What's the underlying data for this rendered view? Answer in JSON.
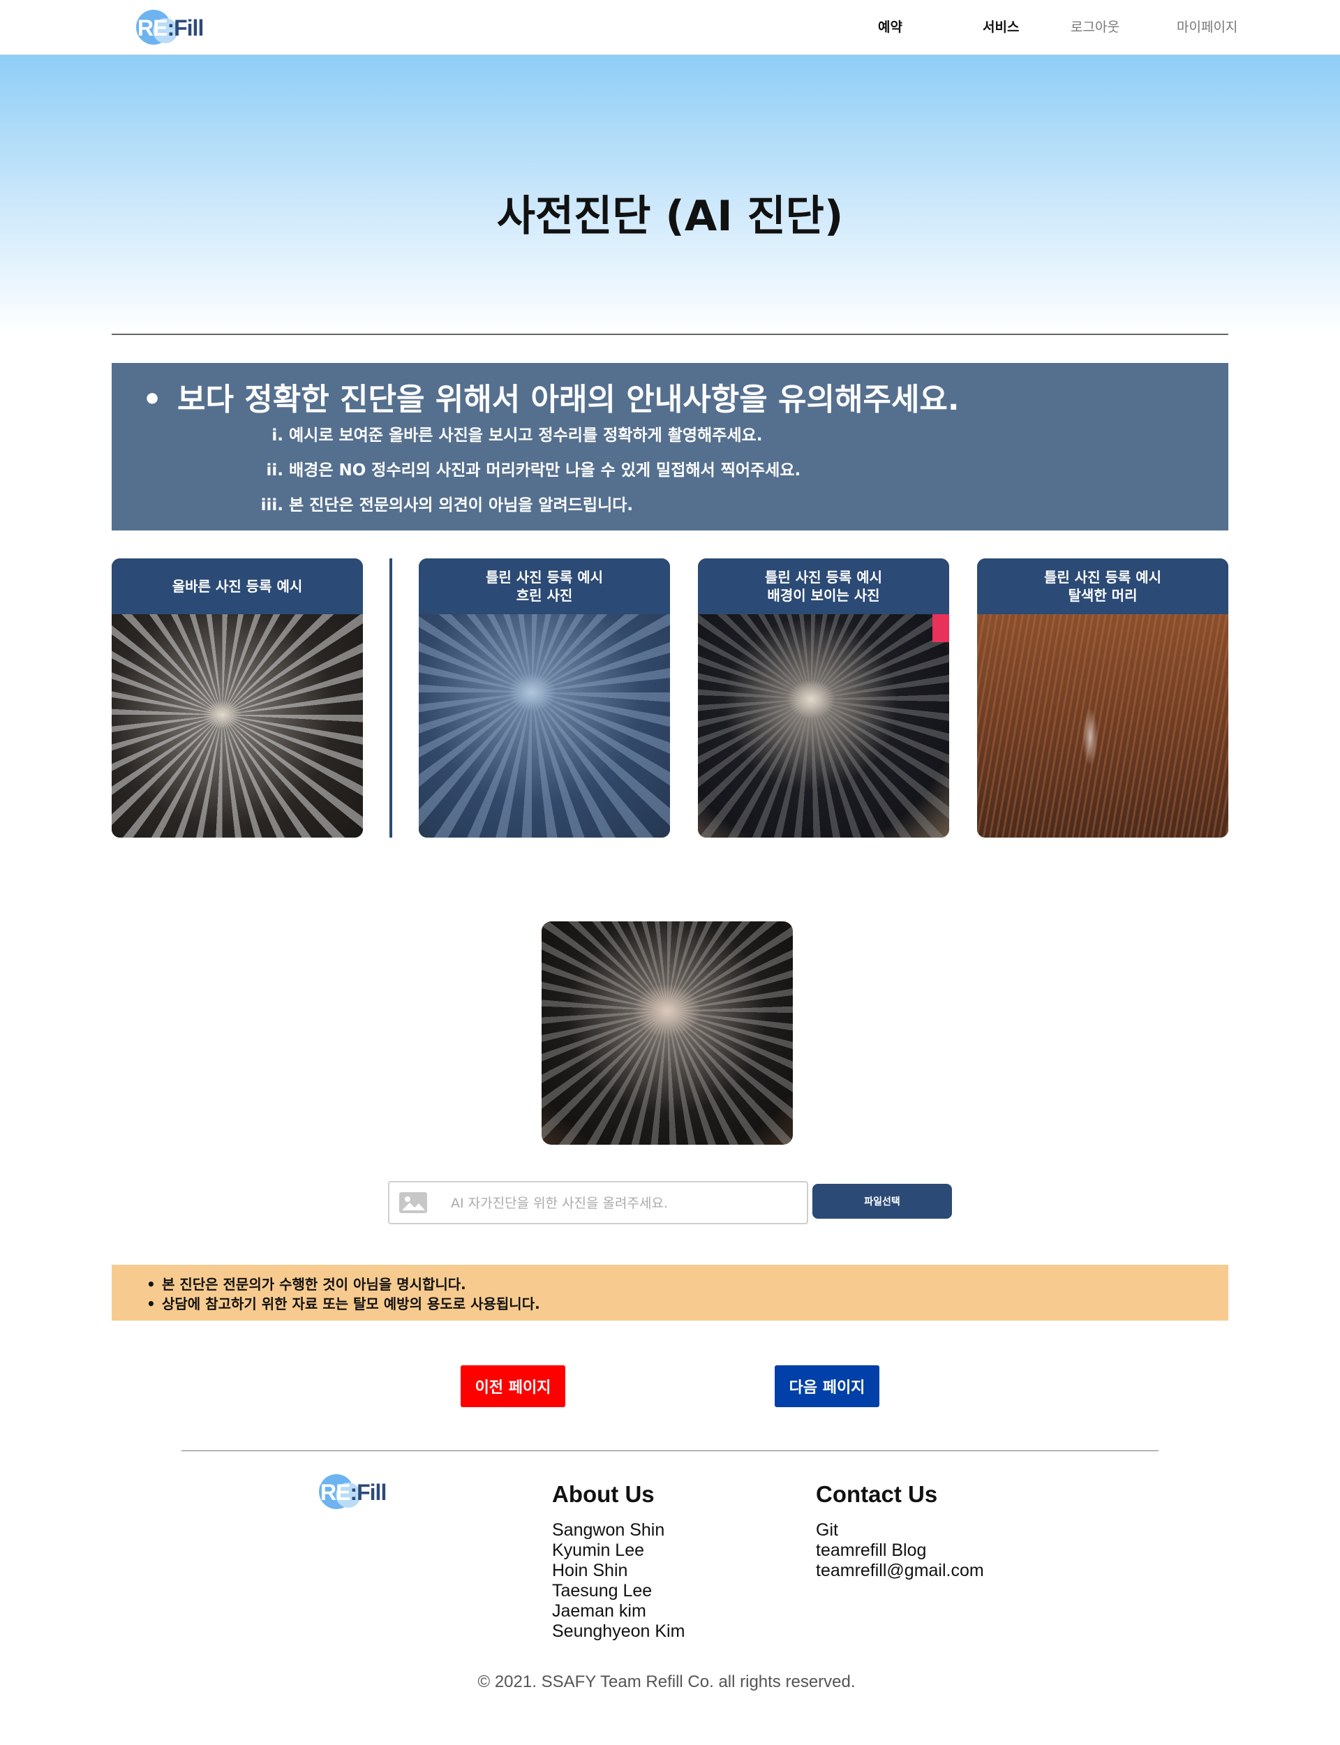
{
  "header": {
    "logo": {
      "re": "RE",
      "colon": ":",
      "fill": "Fill"
    },
    "nav": [
      "예약",
      "서비스",
      "로그아웃",
      "마이페이지"
    ]
  },
  "hero": {
    "title": "사전진단 (AI 진단)"
  },
  "notice": {
    "heading": "보다 정확한 진단을 위해서 아래의 안내사항을 유의해주세요.",
    "items": [
      {
        "num": "i.",
        "text": "예시로 보여준 올바른 사진을 보시고 정수리를 정확하게 촬영해주세요."
      },
      {
        "num": "ii.",
        "text": "배경은 NO 정수리의 사진과 머리카락만 나올 수 있게 밀접해서 찍어주세요."
      },
      {
        "num": "iii.",
        "text": "본 진단은 전문의사의 의견이 아님을 알려드립니다."
      }
    ]
  },
  "examples": [
    {
      "line1": "올바른 사진 등록 예시",
      "line2": ""
    },
    {
      "line1": "틀린 사진 등록 예시",
      "line2": "흐린 사진"
    },
    {
      "line1": "틀린 사진 등록 예시",
      "line2": "배경이 보이는 사진"
    },
    {
      "line1": "틀린 사진 등록 예시",
      "line2": "탈색한 머리"
    }
  ],
  "upload": {
    "placeholder": "AI 자가진단을 위한 사진을 올려주세요.",
    "button": "파일선택",
    "icon": "image-icon"
  },
  "disclaimer": [
    "본 진단은 전문의가 수행한 것이 아님을 명시합니다.",
    "상담에 참고하기 위한 자료 또는 탈모 예방의 용도로 사용됩니다."
  ],
  "buttons": {
    "prev": "이전 페이지",
    "next": "다음 페이지"
  },
  "footer": {
    "about": {
      "title": "About Us",
      "members": [
        "Sangwon Shin",
        "Kyumin Lee",
        "Hoin Shin",
        "Taesung Lee",
        "Jaeman kim",
        "Seunghyeon Kim"
      ]
    },
    "contact": {
      "title": "Contact Us",
      "items": [
        "Git",
        "teamrefill Blog",
        "teamrefill@gmail.com"
      ]
    },
    "copyright": "© 2021. SSAFY Team Refill Co. all rights reserved."
  },
  "colors": {
    "primary": "#2b4a75",
    "notice_bg": "#55708f",
    "disclaimer_bg": "#f7cb8f",
    "prev_button": "#ff0000",
    "next_button": "#0040a8"
  }
}
